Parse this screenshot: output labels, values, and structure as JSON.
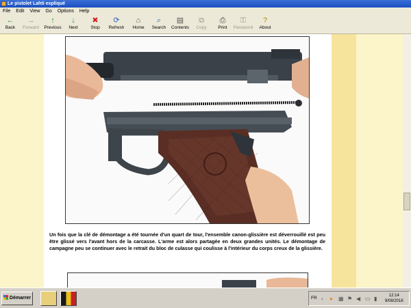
{
  "window": {
    "title": "Le pistolet Lahti expliqué"
  },
  "menu": [
    "File",
    "Edit",
    "View",
    "Go",
    "Options",
    "Help"
  ],
  "toolbar": [
    {
      "label": "Back",
      "icon": "←",
      "enabled": true
    },
    {
      "label": "Forward",
      "icon": "→",
      "enabled": false
    },
    {
      "label": "Previous",
      "icon": "↑",
      "enabled": true
    },
    {
      "label": "Next",
      "icon": "↓",
      "enabled": true
    },
    {
      "label": "Stop",
      "icon": "✖",
      "enabled": true
    },
    {
      "label": "Refresh",
      "icon": "⟳",
      "enabled": true
    },
    {
      "label": "Home",
      "icon": "⌂",
      "enabled": true
    },
    {
      "label": "Search",
      "icon": "⌕",
      "enabled": true
    },
    {
      "label": "Contents",
      "icon": "▤",
      "enabled": true
    },
    {
      "label": "Copy",
      "icon": "⧉",
      "enabled": false
    },
    {
      "label": "Print",
      "icon": "⎙",
      "enabled": true
    },
    {
      "label": "Password",
      "icon": "⚿",
      "enabled": false
    },
    {
      "label": "About",
      "icon": "?",
      "enabled": true
    }
  ],
  "colors": {
    "title_bar": "#1b4fc2",
    "content_bg": "#fbf5c9",
    "stripe_bg": "#f7e49c",
    "gun_metal": "#3a4148",
    "grip": "#5a2e24"
  },
  "article": {
    "paragraph": "Un fois que la clé de démontage a été tournée d'un quart de tour, l'ensemble canon-glissière est déverrouillé est peu être glissé vers l'avant hors de la carcasse. L'arme est alors partagée en deux grandes unités. Le démontage de campagne peu se continuer avec le retrait du bloc de culasse qui coulisse à l'intérieur du corps creux de la glissière."
  },
  "taskbar": {
    "start_label": "Démarrer",
    "tray_lang": "FR",
    "clock_time": "12:14",
    "clock_date": "9/08/2016"
  }
}
